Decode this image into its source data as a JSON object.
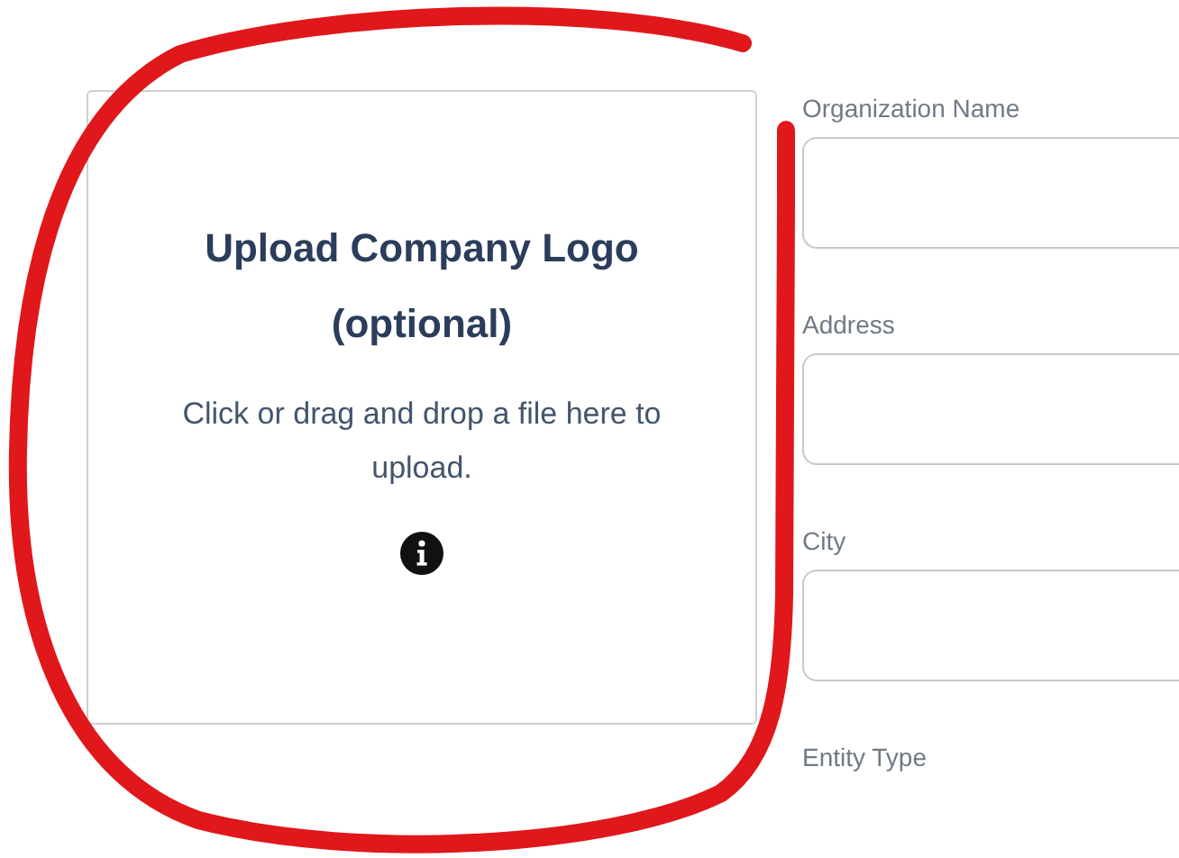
{
  "upload": {
    "title": "Upload Company Logo (optional)",
    "hint": "Click or drag and drop a file here to upload."
  },
  "fields": [
    {
      "label": "Organization Name",
      "kind": "text-field"
    },
    {
      "label": "Address",
      "kind": "text-field"
    },
    {
      "label": "City",
      "kind": "text-field"
    },
    {
      "label": "Entity Type",
      "kind": "label"
    }
  ]
}
